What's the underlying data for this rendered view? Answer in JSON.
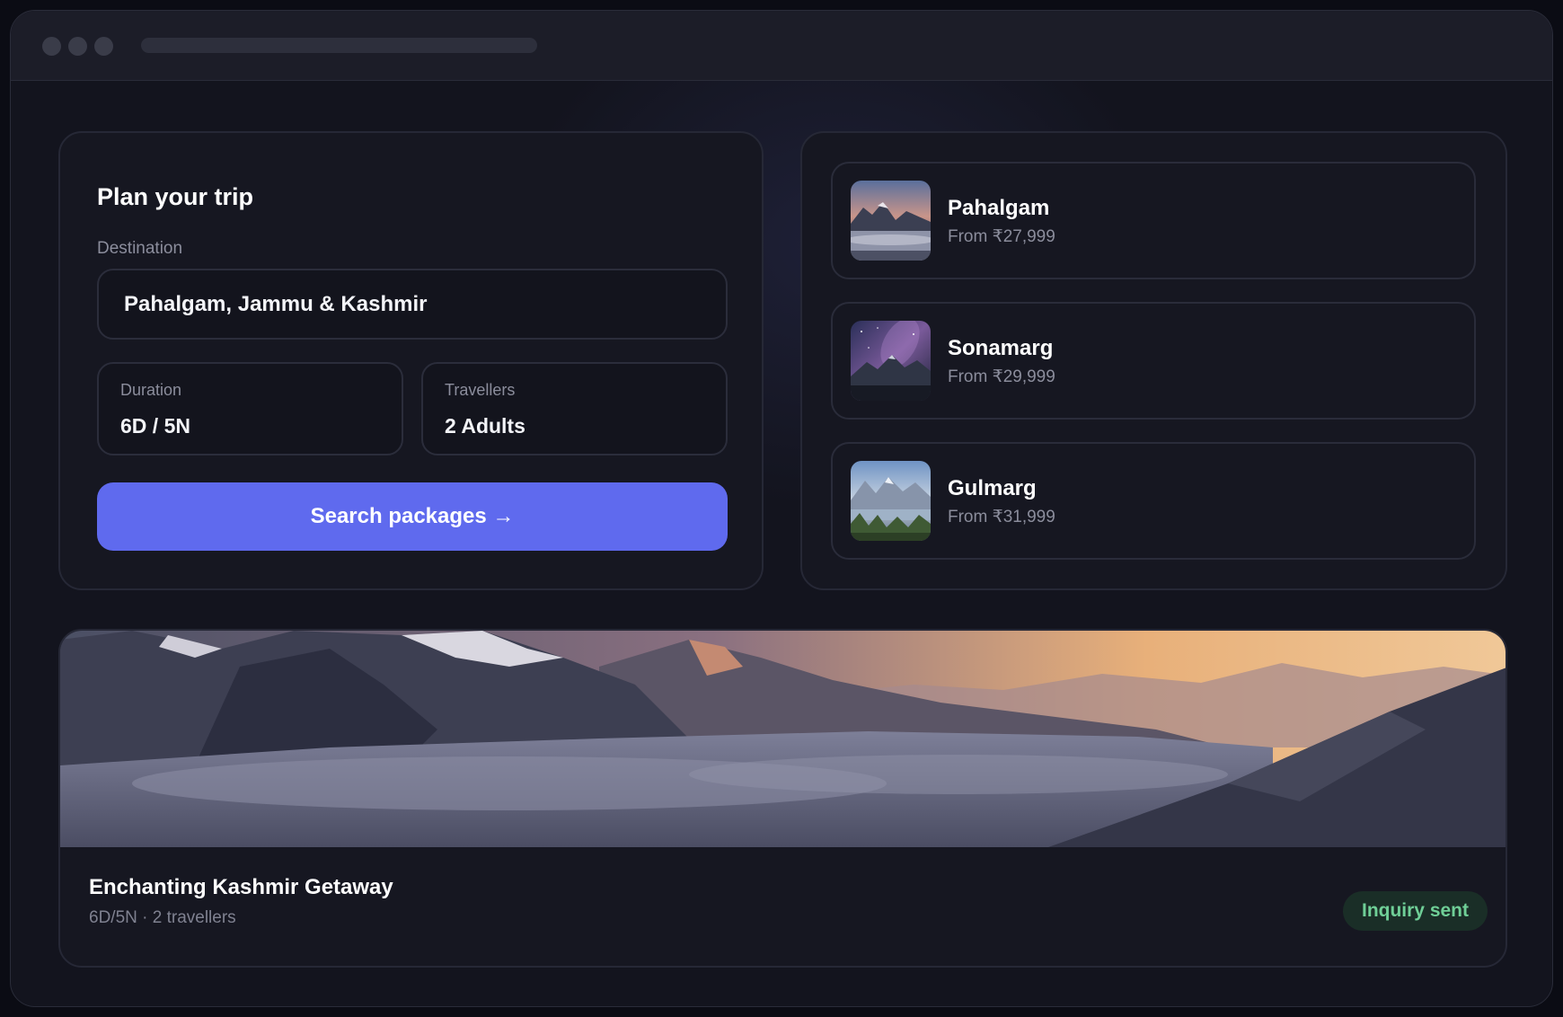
{
  "plan": {
    "title": "Plan your trip",
    "destination_label": "Destination",
    "destination_value": "Pahalgam, Jammu & Kashmir",
    "duration_label": "Duration",
    "duration_value": "6D / 5N",
    "travellers_label": "Travellers",
    "travellers_value": "2 Adults",
    "search_button": "Search packages →"
  },
  "destinations": [
    {
      "name": "Pahalgam",
      "price": "From ₹27,999",
      "image": "mountain-sunset-clouds"
    },
    {
      "name": "Sonamarg",
      "price": "From ₹29,999",
      "image": "milky-way-mountains"
    },
    {
      "name": "Gulmarg",
      "price": "From ₹31,999",
      "image": "alpine-valley-lake"
    }
  ],
  "featured": {
    "title": "Enchanting Kashmir Getaway",
    "subtitle": "6D/5N · 2 travellers",
    "status": "Inquiry sent",
    "image": "mountains-above-clouds-sunset"
  },
  "colors": {
    "accent": "#5f6aee",
    "status_green": "#6fcf97",
    "background": "#13141e"
  }
}
